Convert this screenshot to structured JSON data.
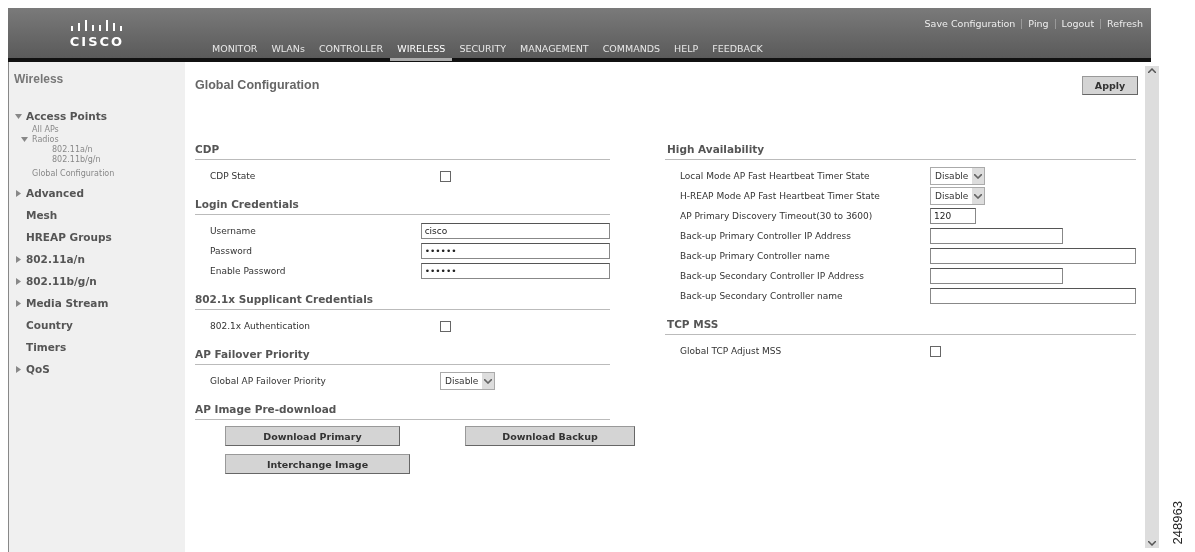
{
  "header": {
    "logo": "CISCO",
    "links": [
      "Save Configuration",
      "Ping",
      "Logout",
      "Refresh"
    ],
    "menu": [
      {
        "label": "MONITOR",
        "selected": false
      },
      {
        "label": "WLANs",
        "selected": false
      },
      {
        "label": "CONTROLLER",
        "selected": false
      },
      {
        "label": "WIRELESS",
        "selected": true
      },
      {
        "label": "SECURITY",
        "selected": false
      },
      {
        "label": "MANAGEMENT",
        "selected": false
      },
      {
        "label": "COMMANDS",
        "selected": false
      },
      {
        "label": "HELP",
        "selected": false
      },
      {
        "label": "FEEDBACK",
        "selected": false
      }
    ]
  },
  "sidebar": {
    "title": "Wireless",
    "items": [
      {
        "label": "Access Points",
        "kind": "folder",
        "expanded": true,
        "children": [
          {
            "label": "All APs",
            "kind": "leaf"
          },
          {
            "label": "Radios",
            "kind": "folder",
            "expanded": true,
            "children": [
              {
                "label": "802.11a/n",
                "kind": "leaf"
              },
              {
                "label": "802.11b/g/n",
                "kind": "leaf"
              }
            ]
          },
          {
            "label": "Global Configuration",
            "kind": "leaf"
          }
        ]
      },
      {
        "label": "Advanced",
        "kind": "folder",
        "expanded": false
      },
      {
        "label": "Mesh",
        "kind": "leaf"
      },
      {
        "label": "HREAP Groups",
        "kind": "leaf"
      },
      {
        "label": "802.11a/n",
        "kind": "folder",
        "expanded": false
      },
      {
        "label": "802.11b/g/n",
        "kind": "folder",
        "expanded": false
      },
      {
        "label": "Media Stream",
        "kind": "folder",
        "expanded": false
      },
      {
        "label": "Country",
        "kind": "leaf"
      },
      {
        "label": "Timers",
        "kind": "leaf"
      },
      {
        "label": "QoS",
        "kind": "folder",
        "expanded": false
      }
    ]
  },
  "main": {
    "title": "Global Configuration",
    "apply_button": "Apply",
    "left_sections": [
      {
        "title": "CDP",
        "rows": [
          {
            "kind": "checkbox",
            "label": "CDP State",
            "checked": false
          }
        ]
      },
      {
        "title": "Login Credentials",
        "rows": [
          {
            "kind": "text",
            "label": "Username",
            "value": "cisco"
          },
          {
            "kind": "text",
            "label": "Password",
            "value": "••••••"
          },
          {
            "kind": "text",
            "label": "Enable Password",
            "value": "••••••"
          }
        ]
      },
      {
        "title": "802.1x Supplicant Credentials",
        "rows": [
          {
            "kind": "checkbox",
            "label": "802.1x Authentication",
            "checked": false
          }
        ]
      },
      {
        "title": "AP Failover Priority",
        "rows": [
          {
            "kind": "select",
            "label": "Global AP Failover Priority",
            "value": "Disable"
          }
        ]
      },
      {
        "title": "AP Image Pre-download",
        "rows": [
          {
            "kind": "buttons",
            "buttons": [
              "Download Primary",
              "Download Backup",
              "Interchange Image"
            ]
          }
        ]
      }
    ],
    "right_sections": [
      {
        "title": "High Availability",
        "rows": [
          {
            "kind": "select",
            "label": "Local Mode AP Fast Heartbeat Timer State",
            "value": "Disable"
          },
          {
            "kind": "select",
            "label": "H-REAP Mode AP Fast Heartbeat Timer State",
            "value": "Disable"
          },
          {
            "kind": "short",
            "label": "AP Primary Discovery Timeout(30 to 3600)",
            "value": "120"
          },
          {
            "kind": "medium",
            "label": "Back-up Primary Controller IP Address"
          },
          {
            "kind": "text",
            "label": "Back-up Primary Controller name"
          },
          {
            "kind": "medium",
            "label": "Back-up Secondary Controller IP Address"
          },
          {
            "kind": "text",
            "label": "Back-up Secondary Controller name"
          }
        ]
      },
      {
        "title": "TCP MSS",
        "rows": [
          {
            "kind": "checkbox",
            "label": "Global TCP Adjust MSS",
            "checked": false
          }
        ]
      }
    ]
  },
  "figure_id": "248963"
}
